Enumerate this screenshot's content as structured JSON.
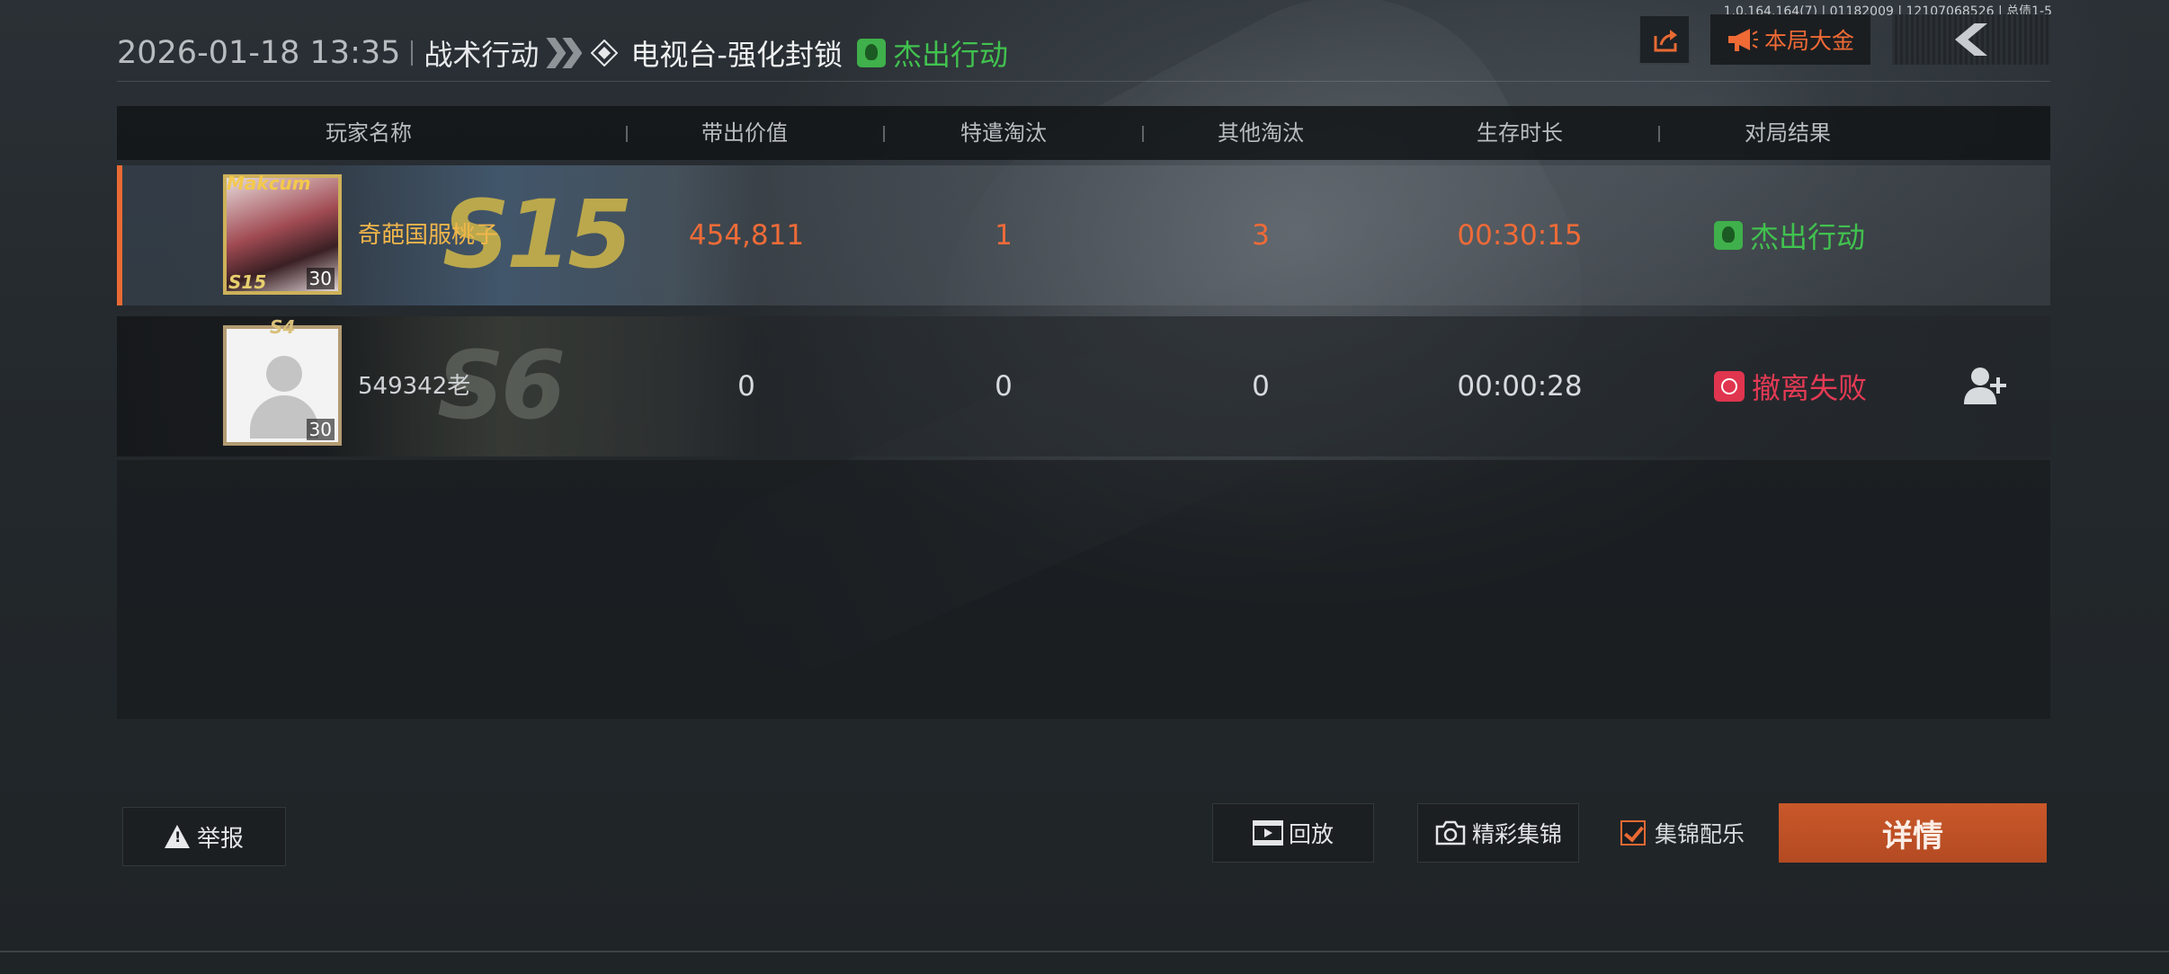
{
  "version": "1.0.164.164(7) | 01182009 | 12107068526 | 总债1-5",
  "header": {
    "datetime": "2026-01-18 13:35",
    "mode": "战术行动",
    "map": "电视台-强化封锁",
    "result": "杰出行动"
  },
  "top_buttons": {
    "bonus_label": "本局大金"
  },
  "table": {
    "columns": [
      "玩家名称",
      "带出价值",
      "特遣淘汰",
      "其他淘汰",
      "生存时长",
      "对局结果"
    ],
    "rows": [
      {
        "name": "奇葩国服桃子",
        "level": "30",
        "season": "S15",
        "avatar_tag": "S15",
        "avatar_top": "Makcum",
        "value": "454,811",
        "special_kills": "1",
        "other_kills": "3",
        "survival": "00:30:15",
        "result": "杰出行动"
      },
      {
        "name": "549342老",
        "level": "30",
        "season": "S6",
        "avatar_tag": "S4",
        "value": "0",
        "special_kills": "0",
        "other_kills": "0",
        "survival": "00:00:28",
        "result": "撤离失败"
      }
    ]
  },
  "bottom": {
    "report_label": "举报",
    "replay_label": "回放",
    "highlights_label": "精彩集锦",
    "music_label": "集锦配乐",
    "music_checked": true,
    "detail_label": "详情"
  },
  "colors": {
    "accent": "#e96a33",
    "success": "#41c24f",
    "fail": "#e43a55"
  }
}
